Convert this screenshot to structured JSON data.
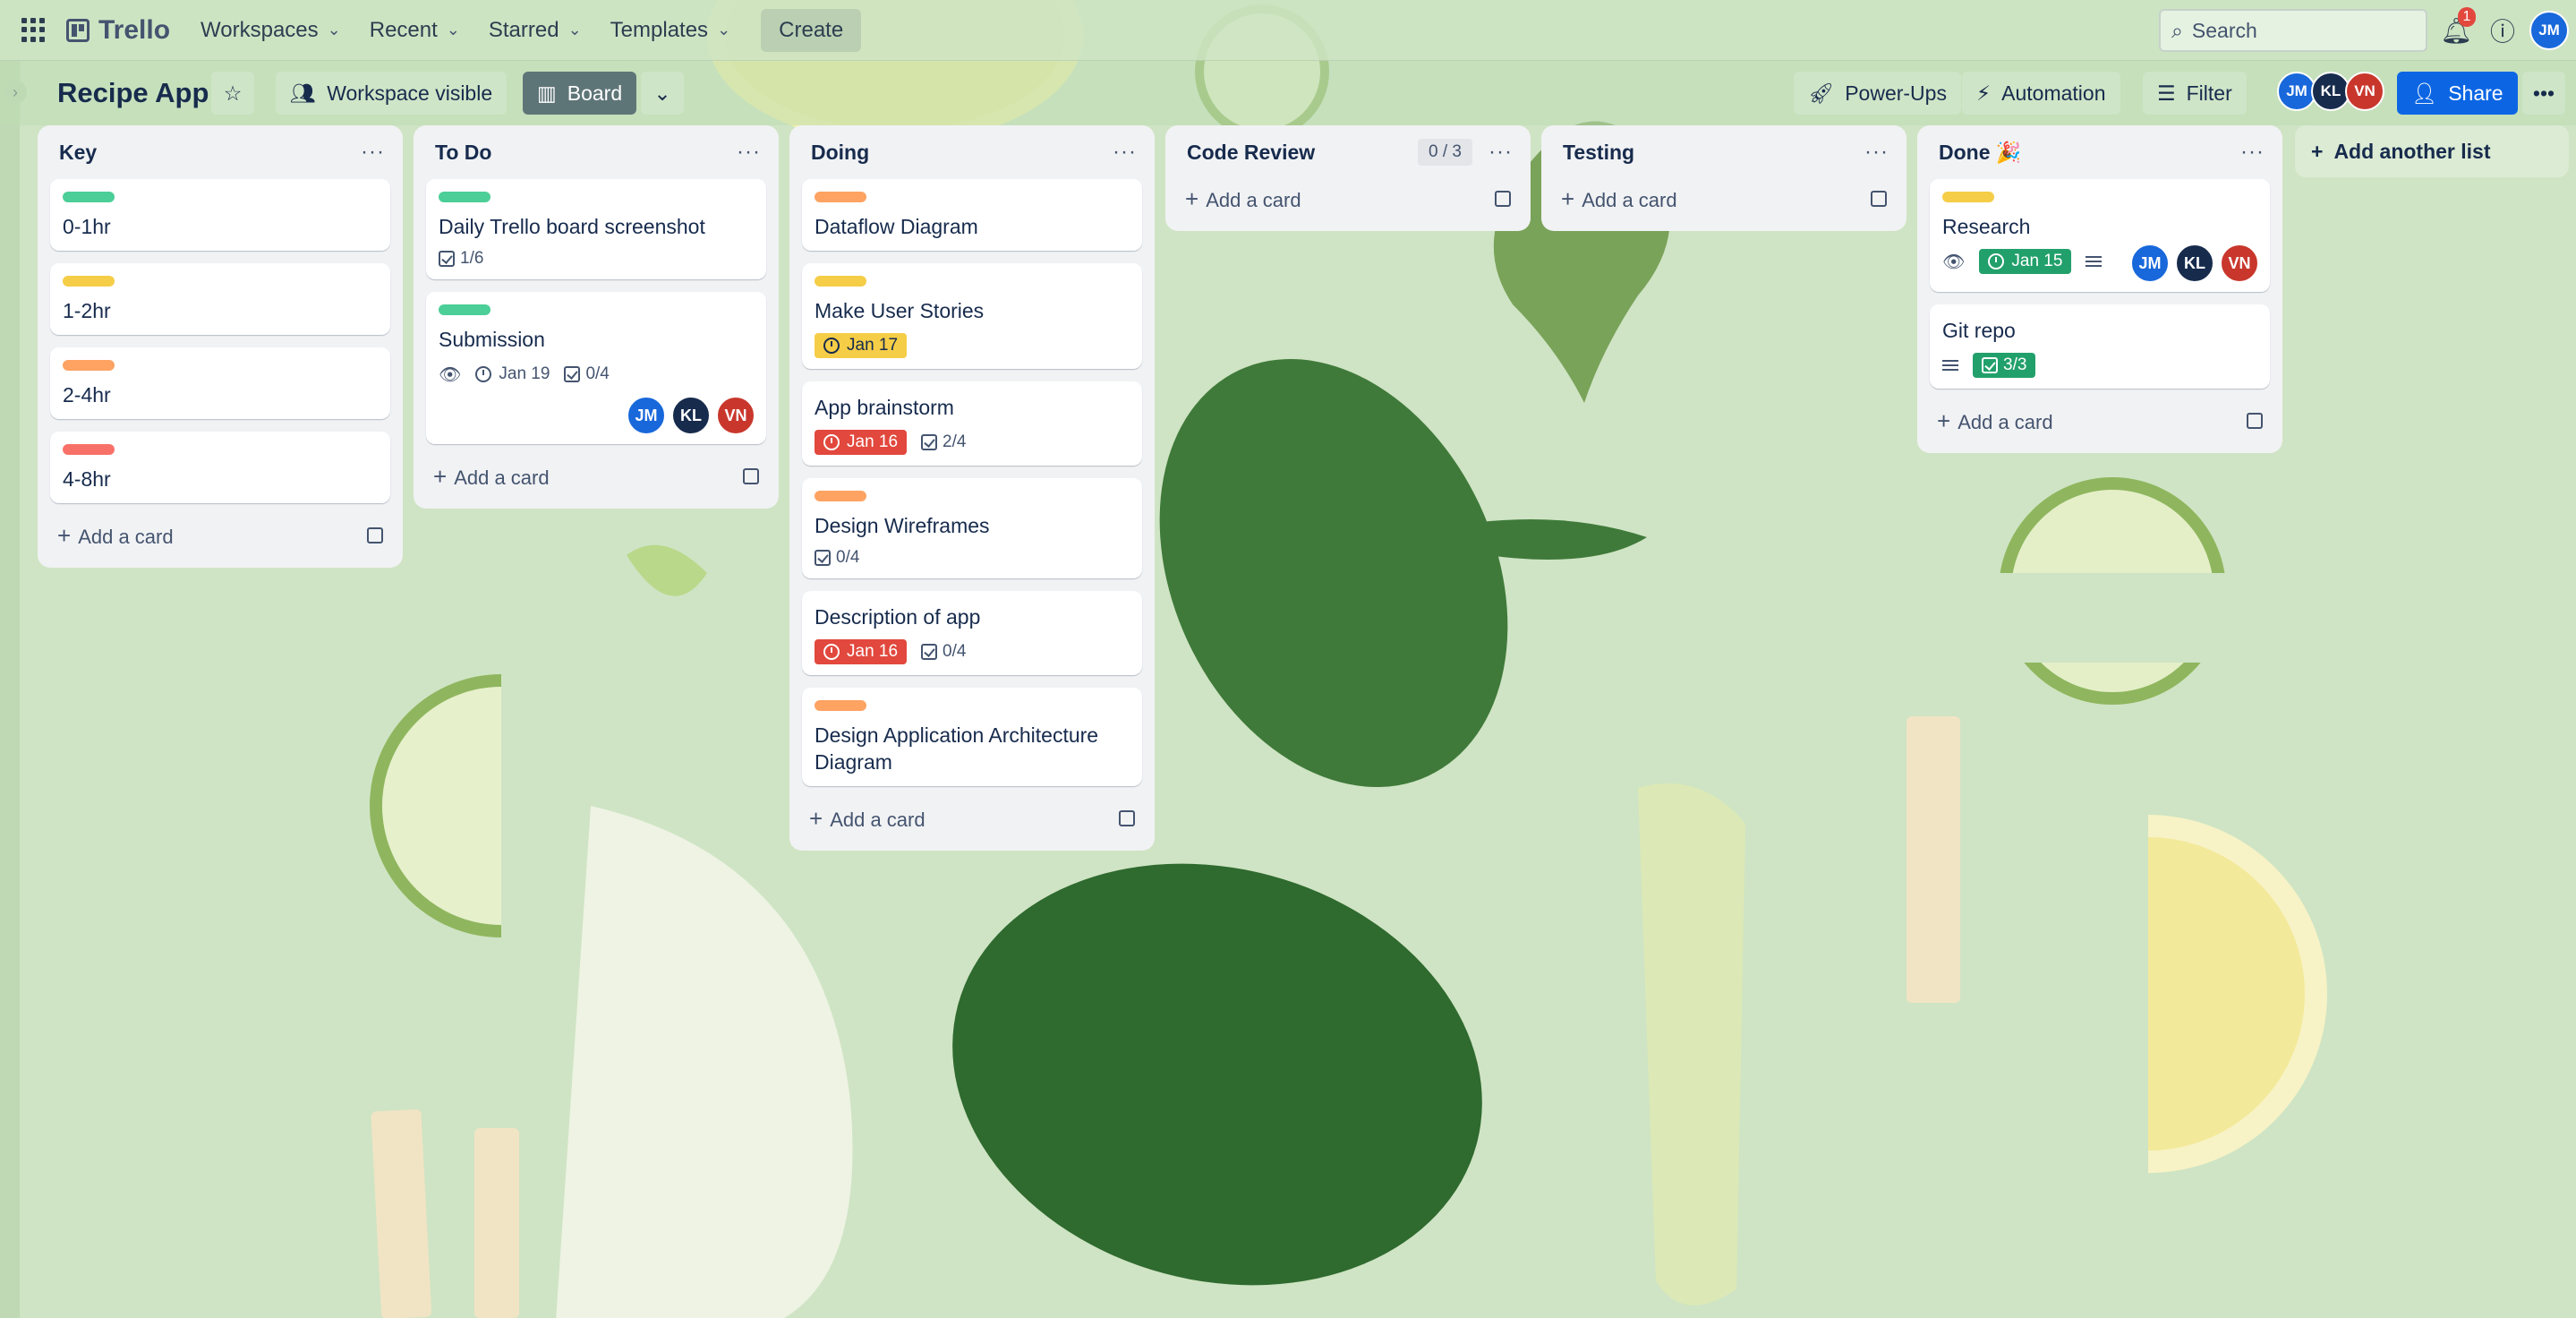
{
  "topbar": {
    "logo": "Trello",
    "nav": [
      "Workspaces",
      "Recent",
      "Starred",
      "Templates"
    ],
    "create_label": "Create",
    "search_placeholder": "Search",
    "notification_count": "1",
    "user_initials": "JM"
  },
  "board": {
    "title": "Recipe App",
    "visibility_label": "Workspace visible",
    "view_label": "Board",
    "power_ups_label": "Power-Ups",
    "automation_label": "Automation",
    "filter_label": "Filter",
    "share_label": "Share",
    "members": [
      {
        "initials": "JM",
        "color": "#1868db"
      },
      {
        "initials": "KL",
        "color": "#172b4d"
      },
      {
        "initials": "VN",
        "color": "#c9372c"
      }
    ]
  },
  "lists": [
    {
      "title": "Key",
      "cards": [
        {
          "title": "0-1hr",
          "label_color": "#4bce97"
        },
        {
          "title": "1-2hr",
          "label_color": "#f5cd47"
        },
        {
          "title": "2-4hr",
          "label_color": "#fea362"
        },
        {
          "title": "4-8hr",
          "label_color": "#f87168"
        }
      ],
      "add_label": "Add a card"
    },
    {
      "title": "To Do",
      "cards": [
        {
          "title": "Daily Trello board screenshot",
          "label_color": "#4bce97",
          "checklist": "1/6"
        },
        {
          "title": "Submission",
          "label_color": "#4bce97",
          "watching": true,
          "due": "Jan 19",
          "checklist": "0/4",
          "members": [
            "JM",
            "KL",
            "VN"
          ]
        }
      ],
      "add_label": "Add a card"
    },
    {
      "title": "Doing",
      "cards": [
        {
          "title": "Dataflow Diagram",
          "label_color": "#fea362"
        },
        {
          "title": "Make User Stories",
          "label_color": "#f5cd47",
          "due": "Jan 17"
        },
        {
          "title": "App brainstorm",
          "due": "Jan 16",
          "checklist": "2/4"
        },
        {
          "title": "Design Wireframes",
          "label_color": "#fea362",
          "checklist": "0/4"
        },
        {
          "title": "Description of app",
          "due": "Jan 16",
          "checklist": "0/4"
        },
        {
          "title": "Design Application Architecture Diagram",
          "label_color": "#fea362"
        }
      ],
      "add_label": "Add a card"
    },
    {
      "title": "Code Review",
      "count": "0 / 3",
      "cards": [],
      "add_label": "Add a card"
    },
    {
      "title": "Testing",
      "cards": [],
      "add_label": "Add a card"
    },
    {
      "title": "Done 🎉",
      "cards": [
        {
          "title": "Research",
          "label_color": "#f5cd47",
          "watching": true,
          "due": "Jan 15",
          "members": [
            "JM",
            "KL",
            "VN"
          ]
        },
        {
          "title": "Git repo",
          "checklist": "3/3"
        }
      ],
      "add_label": "Add a card"
    }
  ],
  "add_list_label": "Add another list",
  "colors": {
    "accent_blue": "#0c66e4",
    "due_overdue": "#e2483d",
    "due_soon": "#f5cd47",
    "complete": "#22a06b",
    "list_bg": "#f1f2f4",
    "board_bg": "#cfe4c4"
  }
}
